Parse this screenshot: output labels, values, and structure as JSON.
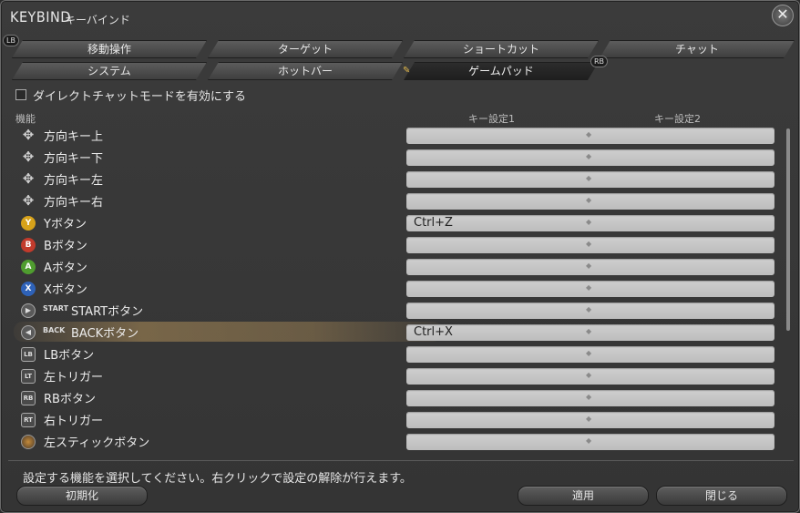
{
  "window": {
    "title": "KEYBIND",
    "subtitle": "キーバインド",
    "close_icon": "close-icon"
  },
  "badges": {
    "lb": "LB",
    "rb": "RB"
  },
  "tabs_row1": [
    {
      "label": "移動操作"
    },
    {
      "label": "ターゲット"
    },
    {
      "label": "ショートカット"
    },
    {
      "label": "チャット"
    }
  ],
  "tabs_row2": [
    {
      "label": "システム"
    },
    {
      "label": "ホットバー"
    },
    {
      "label": "ゲームパッド",
      "active": true
    }
  ],
  "direct_chat": {
    "label": "ダイレクトチャットモードを有効にする",
    "checked": false
  },
  "columns": {
    "function": "機能",
    "key1": "キー設定1",
    "key2": "キー設定2"
  },
  "rows": [
    {
      "icon": "dpad-up-icon",
      "label": "方向キー上",
      "key1": "",
      "key2": ""
    },
    {
      "icon": "dpad-down-icon",
      "label": "方向キー下",
      "key1": "",
      "key2": ""
    },
    {
      "icon": "dpad-left-icon",
      "label": "方向キー左",
      "key1": "",
      "key2": ""
    },
    {
      "icon": "dpad-right-icon",
      "label": "方向キー右",
      "key1": "",
      "key2": ""
    },
    {
      "icon": "y-button-icon",
      "glyph": "Y",
      "label": "Yボタン",
      "key1": "Ctrl+Z",
      "key2": ""
    },
    {
      "icon": "b-button-icon",
      "glyph": "B",
      "label": "Bボタン",
      "key1": "",
      "key2": ""
    },
    {
      "icon": "a-button-icon",
      "glyph": "A",
      "label": "Aボタン",
      "key1": "",
      "key2": ""
    },
    {
      "icon": "x-button-icon",
      "glyph": "X",
      "label": "Xボタン",
      "key1": "",
      "key2": ""
    },
    {
      "icon": "start-button-icon",
      "tag": "START",
      "label": "STARTボタン",
      "key1": "",
      "key2": ""
    },
    {
      "icon": "back-button-icon",
      "tag": "BACK",
      "label": "BACKボタン",
      "key1": "Ctrl+X",
      "key2": "",
      "highlight": true
    },
    {
      "icon": "lb-button-icon",
      "glyph": "LB",
      "label": "LBボタン",
      "key1": "",
      "key2": ""
    },
    {
      "icon": "lt-trigger-icon",
      "glyph": "LT",
      "label": "左トリガー",
      "key1": "",
      "key2": ""
    },
    {
      "icon": "rb-button-icon",
      "glyph": "RB",
      "label": "RBボタン",
      "key1": "",
      "key2": ""
    },
    {
      "icon": "rt-trigger-icon",
      "glyph": "RT",
      "label": "右トリガー",
      "key1": "",
      "key2": ""
    },
    {
      "icon": "left-stick-button-icon",
      "label": "左スティックボタン",
      "key1": "",
      "key2": ""
    }
  ],
  "separator": "◆",
  "hint": "設定する機能を選択してください。右クリックで設定の解除が行えます。",
  "buttons": {
    "reset": "初期化",
    "apply": "適用",
    "close": "閉じる"
  }
}
